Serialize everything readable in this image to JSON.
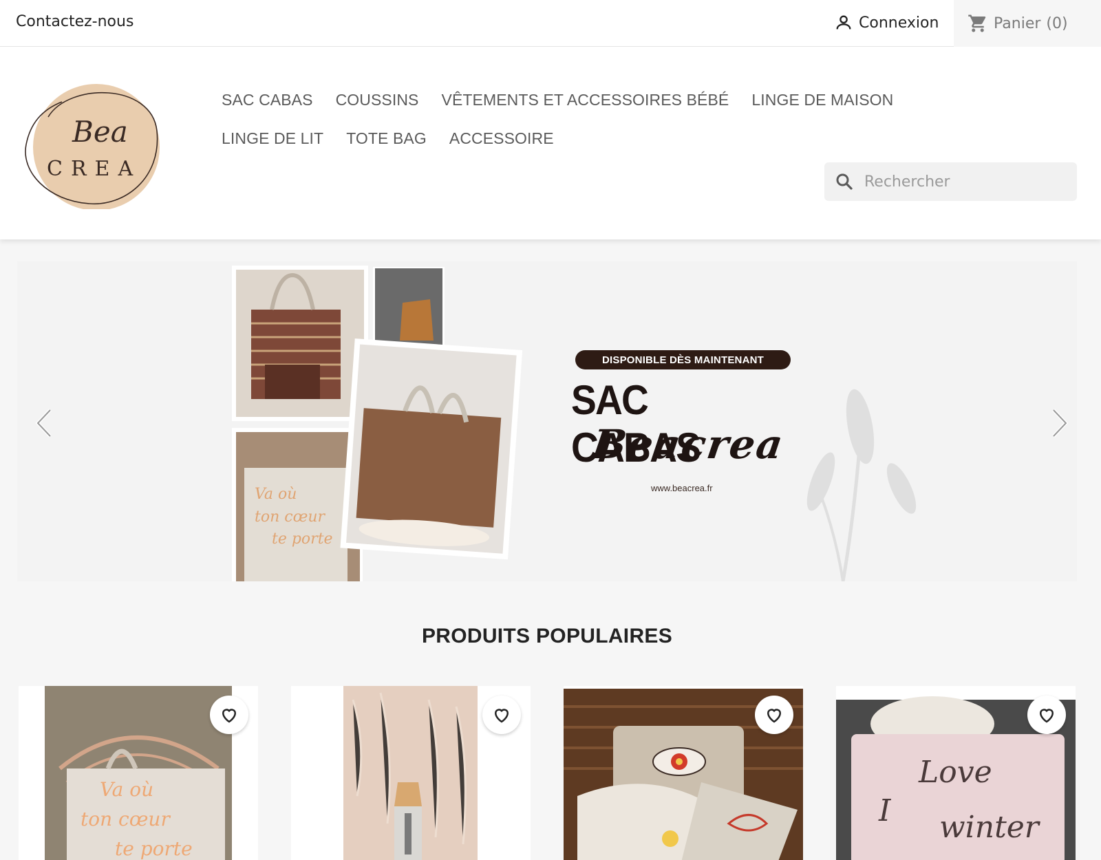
{
  "topbar": {
    "contact_label": "Contactez-nous",
    "login_label": "Connexion",
    "cart_label": "Panier",
    "cart_count": "(0)"
  },
  "brand": {
    "logo_line1": "Bea",
    "logo_line2": "CREA",
    "accent_color": "#e9cdae"
  },
  "nav": {
    "items": [
      {
        "label": "SAC CABAS"
      },
      {
        "label": "COUSSINS"
      },
      {
        "label": "VÊTEMENTS ET ACCESSOIRES BÉBÉ"
      },
      {
        "label": "LINGE DE MAISON"
      },
      {
        "label": "LINGE DE LIT"
      },
      {
        "label": "TOTE BAG"
      },
      {
        "label": "ACCESSOIRE"
      }
    ]
  },
  "search": {
    "placeholder": "Rechercher",
    "icon": "search-icon"
  },
  "hero": {
    "badge": "DISPONIBLE DÈS MAINTENANT",
    "title": "SAC CABAS",
    "script": "Beacrea",
    "url": "www.beacrea.fr"
  },
  "section": {
    "title": "PRODUITS POPULAIRES"
  },
  "products": {
    "items": [
      {
        "name": "tote-bag-brode",
        "text_line1": "Va où",
        "text_line2": "ton cœur",
        "text_line3": "te porte"
      },
      {
        "name": "accessoire-bebe"
      },
      {
        "name": "trousses-brodees"
      },
      {
        "name": "coussin-love-winter",
        "text_line1": "Love",
        "text_line2": "I",
        "text_line3": "winter"
      }
    ]
  }
}
